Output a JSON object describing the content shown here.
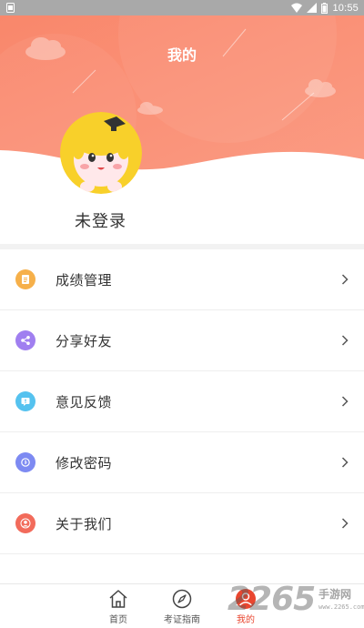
{
  "status_bar": {
    "time": "10:55",
    "icons": [
      "notification-icon",
      "wifi-icon",
      "signal-icon",
      "battery-icon"
    ]
  },
  "header": {
    "title": "我的",
    "login_status": "未登录",
    "gradient_colors": [
      "#f9876b",
      "#fbb3a1"
    ]
  },
  "menu": {
    "items": [
      {
        "label": "成绩管理",
        "icon": "document-icon",
        "icon_color": "#f6b04a"
      },
      {
        "label": "分享好友",
        "icon": "share-icon",
        "icon_color": "#a07ff0"
      },
      {
        "label": "意见反馈",
        "icon": "feedback-icon",
        "icon_color": "#55c2ef"
      },
      {
        "label": "修改密码",
        "icon": "key-icon",
        "icon_color": "#7d8af2"
      },
      {
        "label": "关于我们",
        "icon": "user-icon",
        "icon_color": "#f26b5b"
      }
    ]
  },
  "bottom_nav": {
    "items": [
      {
        "label": "首页",
        "icon": "home-icon",
        "active": false
      },
      {
        "label": "考证指南",
        "icon": "compass-icon",
        "active": false
      },
      {
        "label": "我的",
        "icon": "profile-icon",
        "active": true
      }
    ],
    "active_color": "#e9462f"
  },
  "watermark": {
    "number": "2265",
    "text": "手游网",
    "url": "www.2265.com"
  }
}
